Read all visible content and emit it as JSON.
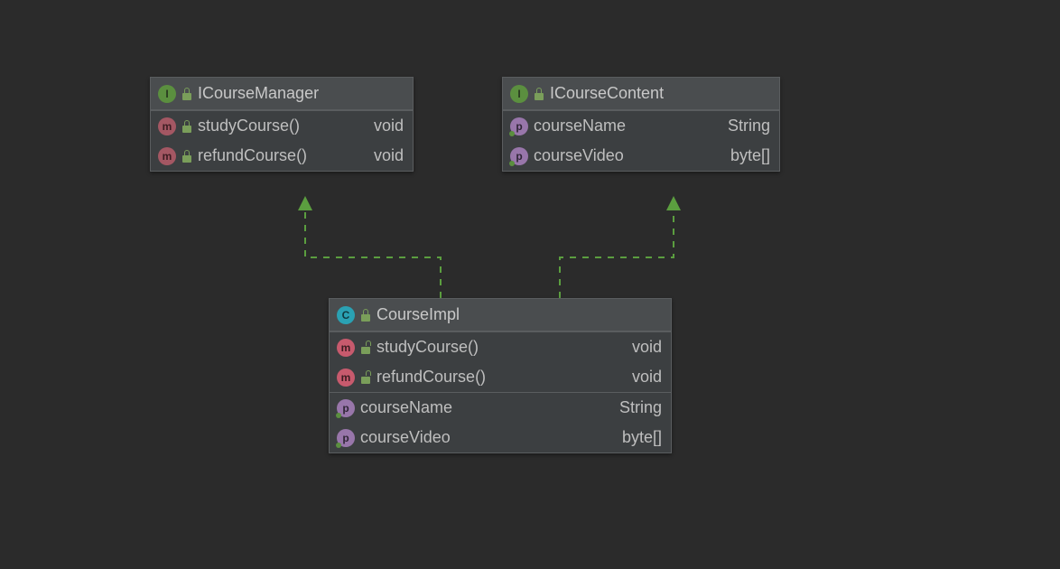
{
  "boxes": {
    "icourseManager": {
      "title": "ICourseManager",
      "badge": "I",
      "members": [
        {
          "name": "studyCourse()",
          "type": "void",
          "badge": "m"
        },
        {
          "name": "refundCourse()",
          "type": "void",
          "badge": "m"
        }
      ]
    },
    "icourseContent": {
      "title": "ICourseContent",
      "badge": "I",
      "members": [
        {
          "name": "courseName",
          "type": "String",
          "badge": "p"
        },
        {
          "name": "courseVideo",
          "type": "byte[]",
          "badge": "p"
        }
      ]
    },
    "courseImpl": {
      "title": "CourseImpl",
      "badge": "C",
      "methods": [
        {
          "name": "studyCourse()",
          "type": "void",
          "badge": "m"
        },
        {
          "name": "refundCourse()",
          "type": "void",
          "badge": "m"
        }
      ],
      "props": [
        {
          "name": "courseName",
          "type": "String",
          "badge": "p"
        },
        {
          "name": "courseVideo",
          "type": "byte[]",
          "badge": "p"
        }
      ]
    }
  },
  "colors": {
    "arrow": "#5b9e3f"
  }
}
